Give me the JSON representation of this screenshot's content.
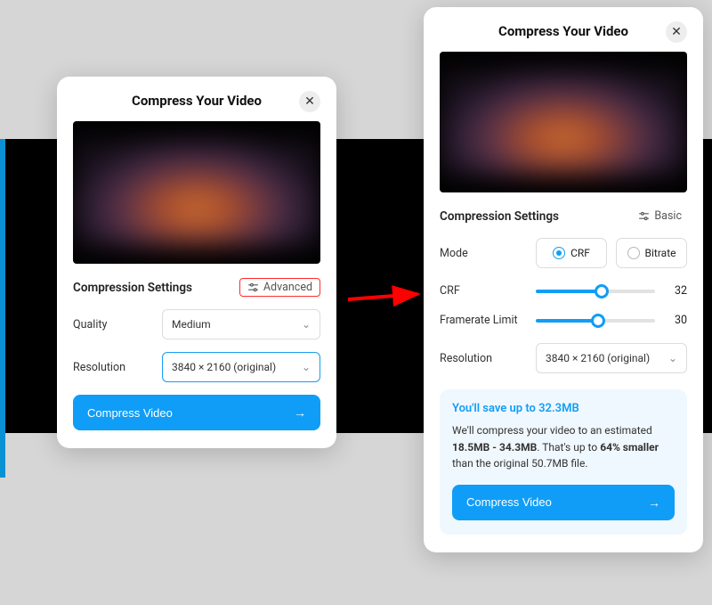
{
  "shared": {
    "title": "Compress Your Video",
    "close_glyph": "✕",
    "settings_heading": "Compression Settings",
    "cta_label": "Compress Video",
    "cta_arrow": "→"
  },
  "panelA": {
    "toggle_label": "Advanced",
    "fields": {
      "quality": {
        "label": "Quality",
        "value": "Medium"
      },
      "resolution": {
        "label": "Resolution",
        "value": "3840 × 2160 (original)"
      }
    }
  },
  "panelB": {
    "toggle_label": "Basic",
    "mode": {
      "label": "Mode",
      "options": [
        "CRF",
        "Bitrate"
      ],
      "selected": "CRF"
    },
    "crf": {
      "label": "CRF",
      "value": 32,
      "pct": 55
    },
    "framerate": {
      "label": "Framerate Limit",
      "value": 30,
      "pct": 52
    },
    "resolution": {
      "label": "Resolution",
      "value": "3840 × 2160 (original)"
    },
    "savings": {
      "headline": "You'll save up to 32.3MB",
      "prefix": "We'll compress your video to an estimated ",
      "range": "18.5MB - 34.3MB",
      "mid": ". That's up to ",
      "pct": "64% smaller",
      "suffix": " than the original 50.7MB file."
    }
  }
}
